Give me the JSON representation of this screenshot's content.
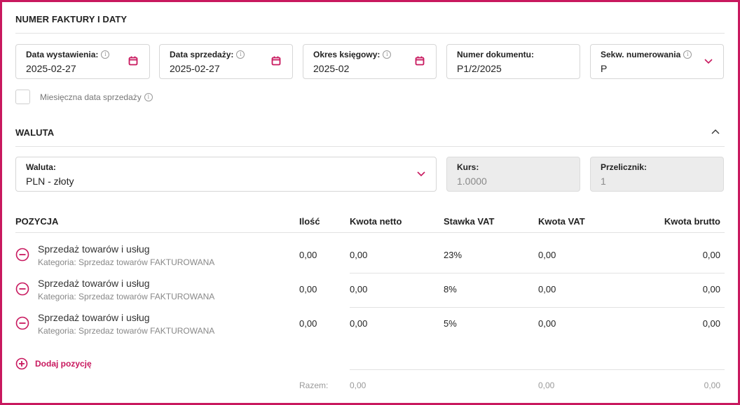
{
  "colors": {
    "accent": "#c8185e",
    "border": "#d6d6d6",
    "disabled_bg": "#ececec"
  },
  "invoice": {
    "section_title": "NUMER FAKTURY I DATY",
    "fields": [
      {
        "label": "Data wystawienia:",
        "value": "2025-02-27",
        "icon": "calendar-icon"
      },
      {
        "label": "Data sprzedaży:",
        "value": "2025-02-27",
        "icon": "calendar-icon"
      },
      {
        "label": "Okres księgowy:",
        "value": "2025-02",
        "icon": "calendar-icon"
      },
      {
        "label": "Numer dokumentu:",
        "value": "P1/2/2025"
      },
      {
        "label": "Sekw. numerowania",
        "value": "P",
        "icon": "chevron-down-icon"
      }
    ],
    "monthly_checkbox_label": "Miesięczna data sprzedaży",
    "monthly_checked": false
  },
  "currency": {
    "section_title": "WALUTA",
    "currency_label": "Waluta:",
    "currency_value": "PLN - złoty",
    "rate_label": "Kurs:",
    "rate_value": "1.0000",
    "converter_label": "Przelicznik:",
    "converter_value": "1"
  },
  "positions": {
    "headers": {
      "position": "POZYCJA",
      "qty": "Ilość",
      "net": "Kwota netto",
      "vat_rate": "Stawka VAT",
      "vat_amount": "Kwota VAT",
      "gross": "Kwota brutto"
    },
    "rows": [
      {
        "title": "Sprzedaż towarów i usług",
        "category": "Kategoria: Sprzedaz towarów FAKTUROWANA",
        "qty": "0,00",
        "net": "0,00",
        "vat_rate": "23%",
        "vat_amount": "0,00",
        "gross": "0,00"
      },
      {
        "title": "Sprzedaż towarów i usług",
        "category": "Kategoria: Sprzedaz towarów FAKTUROWANA",
        "qty": "0,00",
        "net": "0,00",
        "vat_rate": "8%",
        "vat_amount": "0,00",
        "gross": "0,00"
      },
      {
        "title": "Sprzedaż towarów i usług",
        "category": "Kategoria: Sprzedaz towarów FAKTUROWANA",
        "qty": "0,00",
        "net": "0,00",
        "vat_rate": "5%",
        "vat_amount": "0,00",
        "gross": "0,00"
      }
    ],
    "add_label": "Dodaj pozycję",
    "totals": {
      "label": "Razem:",
      "net": "0,00",
      "vat_amount": "0,00",
      "gross": "0,00"
    }
  }
}
